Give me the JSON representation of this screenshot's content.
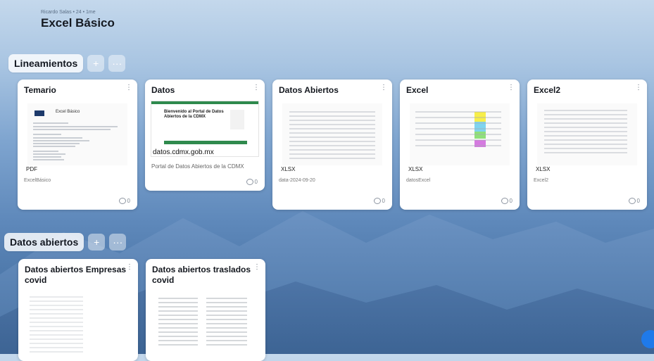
{
  "board": {
    "meta": "Ricardo Salas • 24 • 1me",
    "title": "Excel Básico"
  },
  "sections": [
    {
      "label": "Lineamientos",
      "add_icon": "+",
      "more_icon": "···",
      "cards": [
        {
          "title": "Temario",
          "file_type": "PDF",
          "file_name": "ExcelBásico",
          "comments": "0",
          "thumb_heading": "Excel Básico"
        },
        {
          "title": "Datos",
          "file_type": "",
          "file_name": "Portal de Datos Abiertos de la CDMX",
          "comments": "0",
          "thumb_heading": "Bienvenido al Portal de Datos Abiertos de la CDMX",
          "thumb_url": "datos.cdmx.gob.mx"
        },
        {
          "title": "Datos Abiertos",
          "file_type": "XLSX",
          "file_name": "data-2024-09-20",
          "comments": "0"
        },
        {
          "title": "Excel",
          "file_type": "XLSX",
          "file_name": "datosExcel",
          "comments": "0"
        },
        {
          "title": "Excel2",
          "file_type": "XLSX",
          "file_name": "Excel2",
          "comments": "0"
        }
      ]
    },
    {
      "label": "Datos abiertos",
      "add_icon": "+",
      "more_icon": "···",
      "cards": [
        {
          "title": "Datos abiertos Empresas covid"
        },
        {
          "title": "Datos abiertos traslados covid"
        }
      ]
    }
  ],
  "colors": {
    "accent": "#1f7aea",
    "green_banner": "#2f8a4d"
  },
  "icons": {
    "kebab": "⋮",
    "comment": "comment-icon"
  }
}
